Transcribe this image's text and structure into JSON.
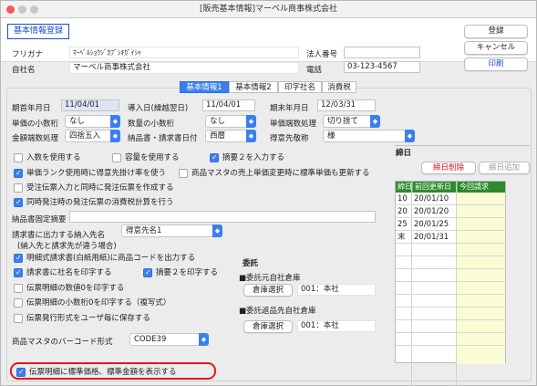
{
  "window": {
    "title": "[販売基本情報]マーベル商事株式会社"
  },
  "header": {
    "screen_title": "基本情報登録",
    "furigana_label": "フリガナ",
    "furigana_value": "ﾏｰﾍﾞﾙｼｮｳｼﾞｶﾌﾞｼｷｶﾞｲｼｬ",
    "company_label": "自社名",
    "company_value": "マーベル商事株式会社",
    "corp_no_label": "法人番号",
    "corp_no_value": "",
    "phone_label": "電話",
    "phone_value": "03-123-4567"
  },
  "buttons": {
    "register": "登録",
    "cancel": "キャンセル",
    "print": "印刷"
  },
  "tabs": [
    "基本情報1",
    "基本情報2",
    "印字社名",
    "消費税"
  ],
  "period": {
    "start_label": "期首年月日",
    "start_value": "11/04/01",
    "intro_label": "導入日(繰越翌日)",
    "intro_value": "11/04/01",
    "end_label": "期末年月日",
    "end_value": "12/03/31"
  },
  "selects": {
    "unit_price_decimal_label": "単価の小数桁",
    "unit_price_decimal_value": "なし",
    "qty_decimal_label": "数量の小数桁",
    "qty_decimal_value": "なし",
    "unit_price_rounding_label": "単価端数処理",
    "unit_price_rounding_value": "切り捨て",
    "amount_rounding_label": "金額端数処理",
    "amount_rounding_value": "四捨五入",
    "invoice_date_label": "納品書・請求書日付",
    "invoice_date_value": "西暦",
    "honorific_label": "得意先敬称",
    "honorific_value": "様"
  },
  "checkboxes": {
    "use_receipt": "入数を使用する",
    "use_capacity": "容量を使用する",
    "summary2_input": "摘要２を入力する",
    "rank_multiplier": "単価ランク使用時に得意先掛け率を使う",
    "update_sales_price": "商品マスタの売上単価変更時に標準単価も更新する",
    "auto_po_on_order": "受注伝票入力と同時に発注伝票を作成する",
    "tax_calc_simultaneous": "同時発注時の発注伝票の消費税計算を行う",
    "print_product_code": "明細式請求書(白紙用紙)に商品コードを出力する",
    "print_company_invoice": "請求書に社名を印字する",
    "print_summary2": "摘要２を印字する",
    "print_qty_zero": "伝票明細の数値0を印字する",
    "print_decimal_zero": "伝票明細の小数桁0を印字する（複写式）",
    "save_slip_format": "伝票発行形式をユーザ毎に保存する",
    "show_standard_price": "伝票明細に標準価格、標準金額を表示する"
  },
  "fixed_summary_label": "納品書固定摘要",
  "fixed_summary_value": "",
  "dest_label": "請求書に出力する納入先名",
  "dest_sublabel": "(納入先と請求先が違う場合)",
  "dest_value": "得意先名1",
  "consign": {
    "title": "委託",
    "src_label": "■委託元自社倉庫",
    "src_button": "倉庫選択",
    "src_value": "001：本社",
    "ret_label": "■委託返品先自社倉庫",
    "ret_button": "倉庫選択",
    "ret_value": "001：本社"
  },
  "barcode_label": "商品マスタのバーコード形式",
  "barcode_value": "CODE39",
  "closing": {
    "title": "締日",
    "delete_button": "締日削除",
    "add_button": "締日追加",
    "columns": [
      "締日",
      "前回更新日",
      "今回請求"
    ],
    "rows": [
      {
        "day": "10",
        "prev": "20/01/10",
        "curr": ""
      },
      {
        "day": "20",
        "prev": "20/01/20",
        "curr": ""
      },
      {
        "day": "25",
        "prev": "20/01/25",
        "curr": ""
      },
      {
        "day": "末",
        "prev": "20/01/31",
        "curr": ""
      }
    ]
  },
  "colors": {
    "accent": "#3a7ff0",
    "grid_header": "#2f8a2f",
    "highlight": "#e01a1a",
    "title_blue": "#1a4fd0"
  }
}
